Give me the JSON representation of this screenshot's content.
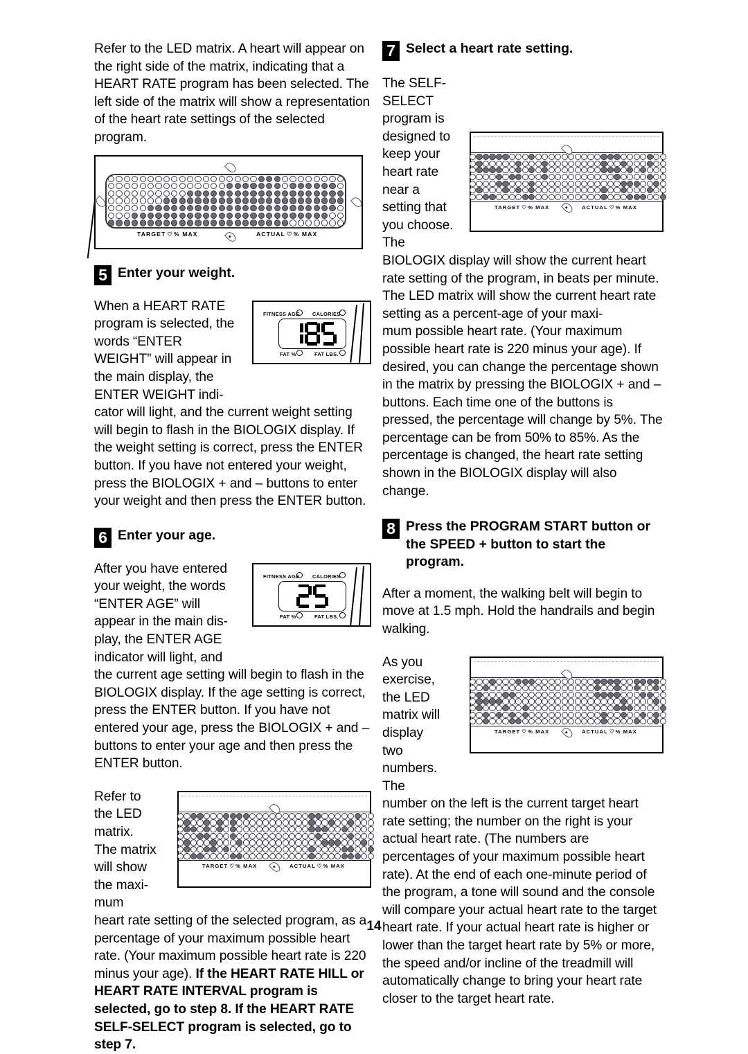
{
  "page": {
    "number": "14"
  },
  "left_column": {
    "intro_paragraph": "Refer to the LED matrix. A heart will appear on the right side of the matrix, indicating that a HEART RATE program has been selected. The left side of the matrix will show a representation of the heart rate settings of the selected program.",
    "step5": {
      "number": "5",
      "title": "Enter your weight.",
      "body_wrap": "When a HEART RATE program is selected, the words “ENTER WEIGHT” will appear in the main display, the ENTER WEIGHT indi-",
      "body_rest": "cator will light, and the current weight setting will begin to flash in the BIOLOGIX display. If the weight setting is correct, press the ENTER button. If you have not entered your weight, press the BIOLOGIX + and – buttons to enter your weight and then press the ENTER button."
    },
    "step6": {
      "number": "6",
      "title": "Enter your age.",
      "body_wrap": "After you have entered your weight, the words “ENTER AGE” will appear in the main dis-play, the ENTER AGE indicator will light, and",
      "body_rest": "the current age setting will begin to flash in the BIOLOGIX display. If the age setting is correct, press the ENTER button. If you have not entered your age, press the BIOLOGIX + and – buttons to enter your age and then press the ENTER button."
    },
    "matrix_paragraph": {
      "wrap": "Refer to the LED matrix. The matrix will show the maxi-mum",
      "plain": "heart rate setting of the selected program, as a percentage of your maximum possible heart rate. (Your maximum possible heart rate is 220 minus your age). ",
      "bold": "If the HEART RATE HILL or HEART RATE INTERVAL program is selected, go to step 8. If the HEART RATE SELF-SELECT program is selected, go to step 7."
    }
  },
  "right_column": {
    "step7": {
      "number": "7",
      "title": "Select a heart rate setting.",
      "body_intro": "The SELF-SELECT program is designed to keep your heart rate near a setting that you choose. The BIOLOGIX display will show the current heart rate setting of the program, in beats per minute. The LED matrix will show the current heart rate setting as a percent-age of your maxi-",
      "body_rest": "mum possible heart rate. (Your maximum possible heart rate is 220 minus your age). If desired, you can change the percentage shown in the matrix by pressing the BIOLOGIX + and – buttons. Each time one of the buttons is pressed, the percentage will change by 5%. The percentage can be from 50% to 85%. As the percentage is changed, the heart rate setting shown in the BIOLOGIX display will also change."
    },
    "step8": {
      "number": "8",
      "title": "Press the PROGRAM START button or the SPEED + button to start the program.",
      "body_intro": "After a moment, the walking belt will begin to move at 1.5 mph. Hold the handrails and begin walking.",
      "body_wrap": "As you exercise, the LED matrix will display two numbers. The",
      "body_rest": "number on the left is the current target heart rate setting; the number on the right is your actual heart rate. (The numbers are percentages of your maximum possible heart rate). At the end of each one-minute period of the program, a tone will sound and the console will compare your actual heart rate to the target heart rate. If your actual heart rate is higher or lower than the target heart rate by 5% or more, the speed and/or incline of the treadmill will automatically change to bring your heart rate closer to the target heart rate."
    }
  },
  "figures": {
    "led_matrix": {
      "target_label": "TARGET",
      "actual_label": "ACTUAL",
      "heart_glyph": "♡",
      "pct_max_label": "% MAX",
      "rows": 7,
      "cols": 30
    },
    "console_weight": {
      "fitness_age_label": "FITNESS AGE",
      "calories_label": "CALORIES",
      "fat_pct_label": "FAT %",
      "fat_lbs_label": "FAT LBS.",
      "value": "185"
    },
    "console_age": {
      "fitness_age_label": "FITNESS AGE",
      "calories_label": "CALORIES",
      "fat_pct_label": "FAT %",
      "fat_lbs_label": "FAT LBS.",
      "value": "25"
    }
  },
  "matrix_patterns": {
    "figure1": [
      "000000000000000000011100000000",
      "000000000000000111111101111110",
      "000000000011111111111111111111",
      "000000011111111111111111111111",
      "000001111111111111111111111110",
      "000111111111111111111111111100",
      "111111111111111111111110000000"
    ],
    "figure2": [
      "011111000100000000001110000100",
      "010000010001000000001001000100",
      "011110010101000000001110101000",
      "000010110001000000000010000100",
      "000011000100000000000001110010",
      "010001010100000000001001000100",
      "001100001100000000001000111001"
    ],
    "figure3": [
      "001100011110000000001100000100",
      "010010101000000000001001001000",
      "011010101000000000001110010000",
      "000110001000000000000100001000",
      "010001000100000000000011100010",
      "010011010000000000001000011001",
      "001100001100000000001000011100"
    ],
    "figure4": [
      "000100011100000000011110011110",
      "001000000000000000010010010010",
      "010001100000000000011110001100",
      "011110000000000000000001000010",
      "010001001000000000000011100001",
      "001010101000000000001001001010",
      "001000110000000000001000010010"
    ]
  }
}
